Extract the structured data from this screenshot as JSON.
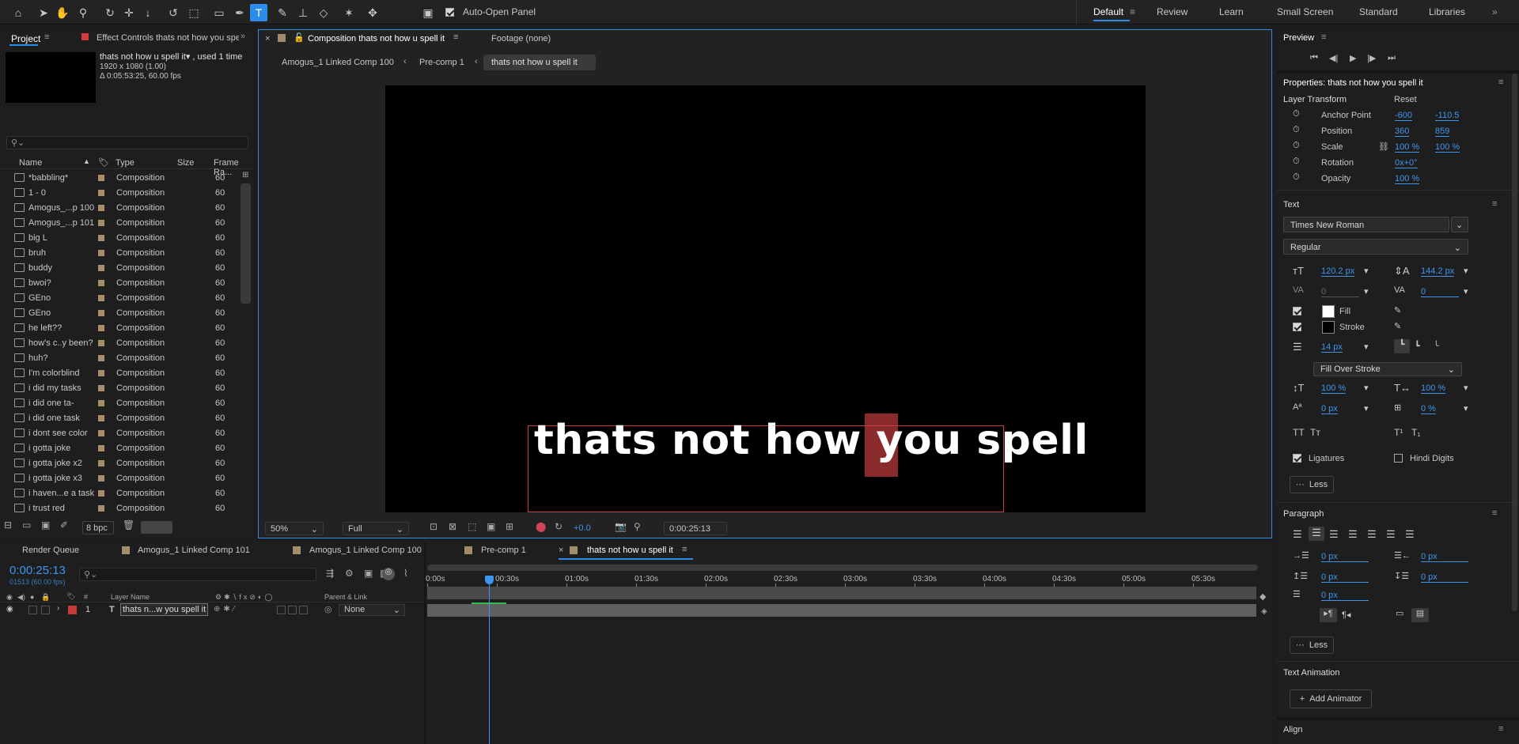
{
  "toolbar": {
    "auto_open_panel": "Auto-Open Panel",
    "workspaces": [
      "Default",
      "Review",
      "Learn",
      "Small Screen",
      "Standard",
      "Libraries"
    ]
  },
  "project": {
    "tab_project": "Project",
    "tab_effect": "Effect Controls thats not how you spe",
    "thumb_name": "thats not how u spell it",
    "thumb_used": ", used 1 time",
    "thumb_res": "1920 x 1080 (1.00)",
    "thumb_dur": "Δ 0:05:53:25, 60.00 fps",
    "search_placeholder": "",
    "col_name": "Name",
    "col_type": "Type",
    "col_size": "Size",
    "col_fps": "Frame Ra...",
    "items": [
      {
        "name": "*babbling*",
        "type": "Composition",
        "fps": "60"
      },
      {
        "name": "1 - 0",
        "type": "Composition",
        "fps": "60"
      },
      {
        "name": "Amogus_...p 100",
        "type": "Composition",
        "fps": "60"
      },
      {
        "name": "Amogus_...p 101",
        "type": "Composition",
        "fps": "60"
      },
      {
        "name": "big L",
        "type": "Composition",
        "fps": "60"
      },
      {
        "name": "bruh",
        "type": "Composition",
        "fps": "60"
      },
      {
        "name": "buddy",
        "type": "Composition",
        "fps": "60"
      },
      {
        "name": "bwoi?",
        "type": "Composition",
        "fps": "60"
      },
      {
        "name": "GEno",
        "type": "Composition",
        "fps": "60"
      },
      {
        "name": "GEno",
        "type": "Composition",
        "fps": "60"
      },
      {
        "name": "he left??",
        "type": "Composition",
        "fps": "60"
      },
      {
        "name": "how's c..y been?",
        "type": "Composition",
        "fps": "60"
      },
      {
        "name": "huh?",
        "type": "Composition",
        "fps": "60"
      },
      {
        "name": "I'm colorblind",
        "type": "Composition",
        "fps": "60"
      },
      {
        "name": "i did my tasks",
        "type": "Composition",
        "fps": "60"
      },
      {
        "name": "i did one ta-",
        "type": "Composition",
        "fps": "60"
      },
      {
        "name": "i did one task",
        "type": "Composition",
        "fps": "60"
      },
      {
        "name": "i dont see color",
        "type": "Composition",
        "fps": "60"
      },
      {
        "name": "i gotta joke",
        "type": "Composition",
        "fps": "60"
      },
      {
        "name": "i gotta joke x2",
        "type": "Composition",
        "fps": "60"
      },
      {
        "name": "i gotta joke x3",
        "type": "Composition",
        "fps": "60"
      },
      {
        "name": "i haven...e a task",
        "type": "Composition",
        "fps": "60"
      },
      {
        "name": "i trust red",
        "type": "Composition",
        "fps": "60"
      }
    ],
    "bpc": "8 bpc"
  },
  "comp": {
    "tab_comp": "Composition thats not how u spell it",
    "tab_footage": "Footage (none)",
    "crumbs": [
      "Amogus_1 Linked Comp 100",
      "Pre-comp 1",
      "thats not how u spell it"
    ],
    "canvas_text": "thats not how you spell",
    "zoom": "50%",
    "quality": "Full",
    "exposure": "+0.0",
    "timecode": "0:00:25:13"
  },
  "timeline": {
    "tabs": [
      "Render Queue",
      "Amogus_1 Linked Comp 101",
      "Amogus_1 Linked Comp 100",
      "Pre-comp 1",
      "thats not how u spell it"
    ],
    "time": "0:00:25:13",
    "frames": "01513 (60.00 fps)",
    "col_layer": "Layer Name",
    "col_parent": "Parent & Link",
    "layer_num": "1",
    "layer_name": "thats n...w you spell it",
    "parent": "None",
    "ticks": [
      "0:00s",
      "00:30s",
      "01:00s",
      "01:30s",
      "02:00s",
      "02:30s",
      "03:00s",
      "03:30s",
      "04:00s",
      "04:30s",
      "05:00s",
      "05:30s"
    ]
  },
  "preview": {
    "title": "Preview"
  },
  "properties": {
    "title": "Properties: thats not how you spell it",
    "layer_transform": "Layer Transform",
    "reset": "Reset",
    "anchor": "Anchor Point",
    "anchor_x": "-600",
    "anchor_y": "-110.5",
    "position": "Position",
    "pos_x": "360",
    "pos_y": "859",
    "scale": "Scale",
    "scale_x": "100 %",
    "scale_y": "100 %",
    "rotation": "Rotation",
    "rot": "0x+0°",
    "opacity": "Opacity",
    "opa": "100 %",
    "text_section": "Text",
    "font": "Times New Roman",
    "style": "Regular",
    "font_size": "120.2 px",
    "leading": "144.2 px",
    "kerning": "0",
    "tracking": "0",
    "fill": "Fill",
    "stroke": "Stroke",
    "stroke_w": "14 px",
    "fill_over": "Fill Over Stroke",
    "vscale": "100 %",
    "hscale": "100 %",
    "baseline": "0 px",
    "tsume": "0 %",
    "ligatures": "Ligatures",
    "hindi": "Hindi Digits",
    "less": "Less",
    "paragraph": "Paragraph",
    "indent_l": "0 px",
    "indent_r": "0 px",
    "space_b": "0 px",
    "space_a": "0 px",
    "first": "0 px",
    "text_anim": "Text Animation",
    "add_anim": "Add Animator",
    "align": "Align"
  }
}
